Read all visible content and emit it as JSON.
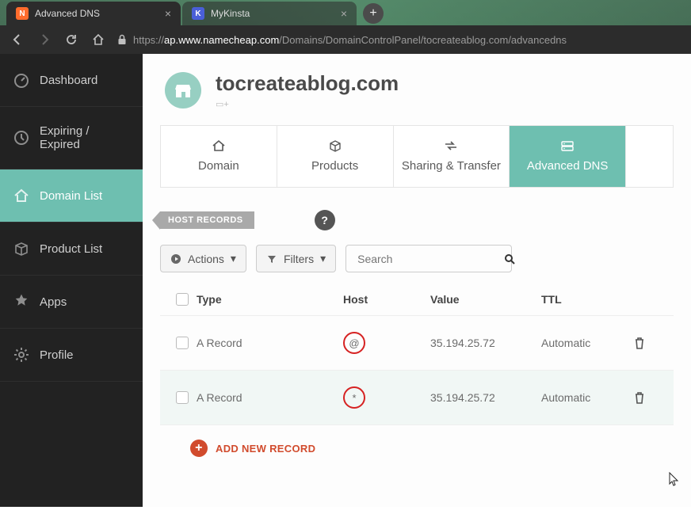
{
  "browser": {
    "tabs": [
      {
        "label": "Advanced DNS",
        "favicon": "N",
        "active": true
      },
      {
        "label": "MyKinsta",
        "favicon": "K",
        "active": false
      }
    ],
    "url_prefix": "https://",
    "url_host": "ap.www.namecheap.com",
    "url_path": "/Domains/DomainControlPanel/tocreateablog.com/advancedns"
  },
  "sidebar": {
    "items": [
      {
        "label": "Dashboard"
      },
      {
        "label": "Expiring / Expired"
      },
      {
        "label": "Domain List"
      },
      {
        "label": "Product List"
      },
      {
        "label": "Apps"
      },
      {
        "label": "Profile"
      }
    ],
    "active_index": 2
  },
  "domain": {
    "title": "tocreateablog.com"
  },
  "tabs": {
    "items": [
      "Domain",
      "Products",
      "Sharing & Transfer",
      "Advanced DNS"
    ],
    "active_index": 3
  },
  "section": {
    "label": "HOST RECORDS",
    "help": "?"
  },
  "controls": {
    "actions": "Actions",
    "filters": "Filters",
    "search_placeholder": "Search"
  },
  "table": {
    "headers": {
      "type": "Type",
      "host": "Host",
      "value": "Value",
      "ttl": "TTL"
    },
    "rows": [
      {
        "type": "A Record",
        "host": "@",
        "value": "35.194.25.72",
        "ttl": "Automatic"
      },
      {
        "type": "A Record",
        "host": "*",
        "value": "35.194.25.72",
        "ttl": "Automatic"
      }
    ]
  },
  "add_record": "ADD NEW RECORD"
}
